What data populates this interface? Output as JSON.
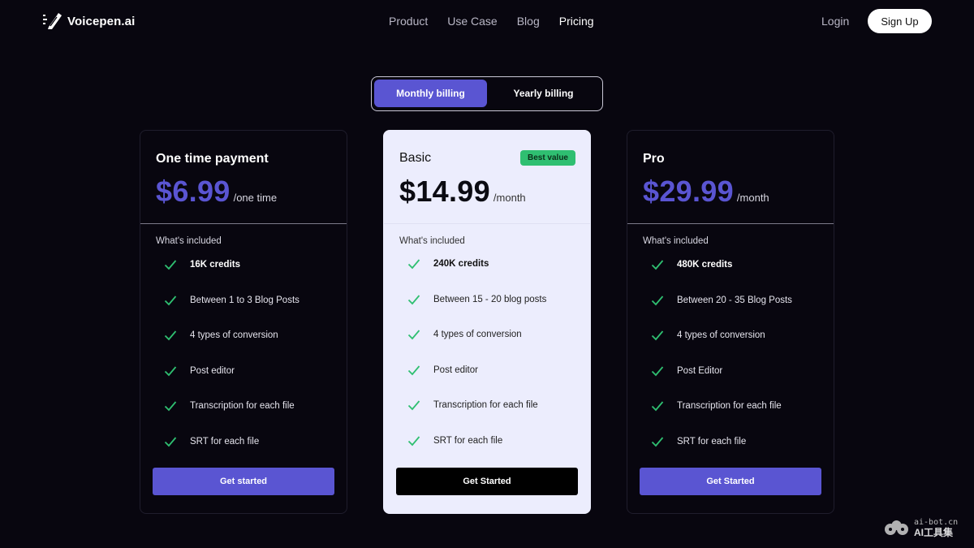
{
  "header": {
    "logo_text": "Voicepen.ai",
    "nav": [
      {
        "label": "Product",
        "active": false
      },
      {
        "label": "Use Case",
        "active": false
      },
      {
        "label": "Blog",
        "active": false
      },
      {
        "label": "Pricing",
        "active": true
      }
    ],
    "login_label": "Login",
    "signup_label": "Sign Up"
  },
  "billing_toggle": {
    "monthly_label": "Monthly billing",
    "yearly_label": "Yearly billing",
    "selected": "monthly"
  },
  "plans": [
    {
      "title": "One time payment",
      "badge": "",
      "price": "$6.99",
      "period": "/one time",
      "included_label": "What's included",
      "features": [
        "16K credits",
        "Between 1 to 3 Blog Posts",
        "4 types of conversion",
        "Post editor",
        "Transcription for each file",
        "SRT for each file"
      ],
      "cta_label": "Get started"
    },
    {
      "title": "Basic",
      "badge": "Best value",
      "price": "$14.99",
      "period": "/month",
      "included_label": "What's included",
      "features": [
        "240K credits",
        "Between 15 - 20 blog posts",
        "4 types of conversion",
        "Post editor",
        "Transcription for each file",
        "SRT for each file"
      ],
      "cta_label": "Get Started"
    },
    {
      "title": "Pro",
      "badge": "",
      "price": "$29.99",
      "period": "/month",
      "included_label": "What's included",
      "features": [
        "480K credits",
        "Between 20 - 35 Blog Posts",
        "4 types of conversion",
        "Post Editor",
        "Transcription for each file",
        "SRT for each file"
      ],
      "cta_label": "Get Started"
    }
  ],
  "colors": {
    "background": "#08060f",
    "accent": "#5a55d2",
    "featured_card": "#ecedfd",
    "badge_green": "#2fbf71",
    "check_green": "#2fbf71"
  },
  "icons": {
    "logo": "pen-microphone-icon",
    "feature": "check-icon",
    "watermark": "robot-icon"
  },
  "watermark": {
    "url": "ai-bot.cn",
    "name": "AI工具集"
  }
}
